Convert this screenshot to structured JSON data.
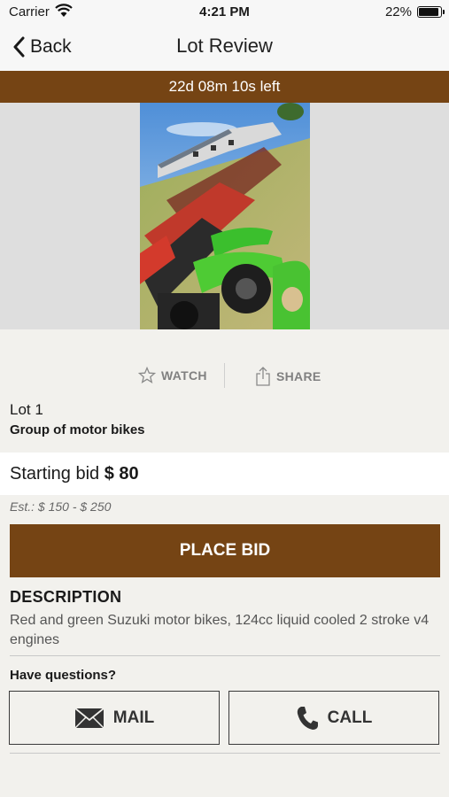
{
  "status_bar": {
    "carrier": "Carrier",
    "time": "4:21 PM",
    "battery": "22%"
  },
  "nav": {
    "back_label": "Back",
    "title": "Lot Review"
  },
  "timer": "22d 08m 10s left",
  "actions": {
    "watch": "WATCH",
    "share": "SHARE"
  },
  "lot": {
    "number": "Lot 1",
    "title": "Group of motor bikes",
    "bid_label": "Starting bid",
    "bid_amount": "$ 80",
    "estimate": "Est.: $ 150 - $ 250",
    "place_bid": "PLACE BID",
    "description_heading": "DESCRIPTION",
    "description": "Red and green Suzuki motor bikes, 124cc liquid cooled 2 stroke v4 engines"
  },
  "contact": {
    "prompt": "Have questions?",
    "mail": "MAIL",
    "call": "CALL"
  },
  "colors": {
    "accent": "#754414",
    "background": "#f2f1ed"
  }
}
